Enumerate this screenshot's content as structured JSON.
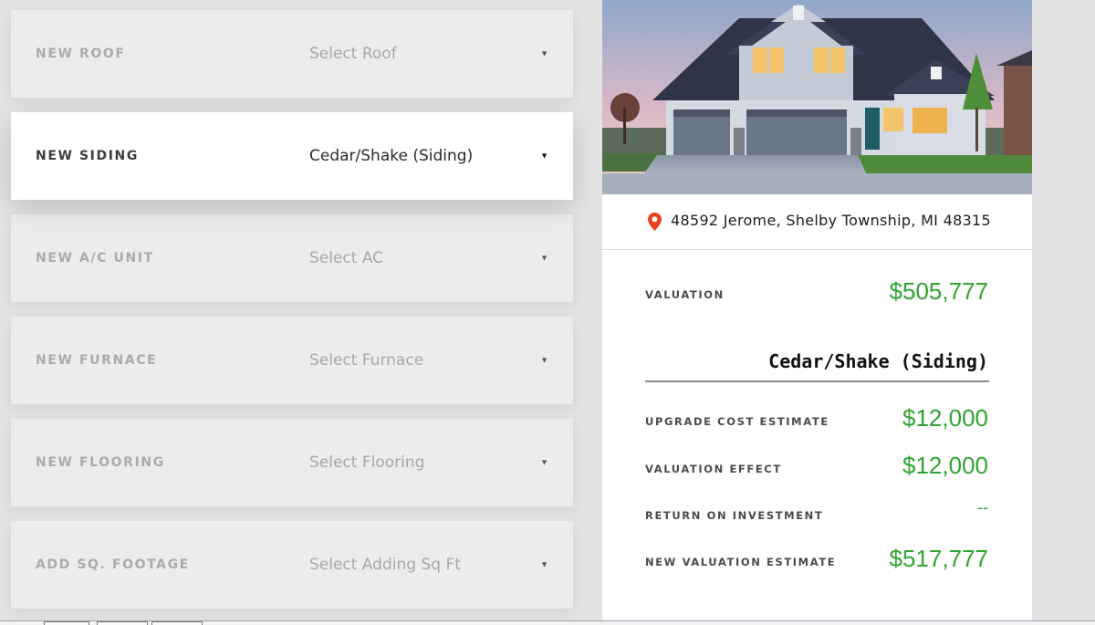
{
  "upgrades": [
    {
      "label": "NEW ROOF",
      "value": "Select Roof",
      "selected": false
    },
    {
      "label": "NEW SIDING",
      "value": "Cedar/Shake (Siding)",
      "selected": true
    },
    {
      "label": "NEW A/C UNIT",
      "value": "Select AC",
      "selected": false
    },
    {
      "label": "NEW FURNACE",
      "value": "Select Furnace",
      "selected": false
    },
    {
      "label": "NEW FLOORING",
      "value": "Select Flooring",
      "selected": false
    },
    {
      "label": "ADD SQ. FOOTAGE",
      "value": "Select Adding Sq Ft",
      "selected": false
    }
  ],
  "property": {
    "address": "48592 Jerome, Shelby Township, MI 48315",
    "valuation_label": "VALUATION",
    "valuation": "$505,777",
    "selected_upgrade": "Cedar/Shake (Siding)",
    "metrics": [
      {
        "label": "UPGRADE COST ESTIMATE",
        "value": "$12,000"
      },
      {
        "label": "VALUATION EFFECT",
        "value": "$12,000"
      },
      {
        "label": "RETURN ON INVESTMENT",
        "value": "--"
      },
      {
        "label": "NEW VALUATION ESTIMATE",
        "value": "$517,777"
      }
    ]
  },
  "icons": {
    "caret": "caret-down-icon",
    "location": "map-pin-icon"
  },
  "colors": {
    "value_green": "#2ea52e",
    "pin_red": "#e8401c",
    "page_bg": "#e2e2e2"
  }
}
